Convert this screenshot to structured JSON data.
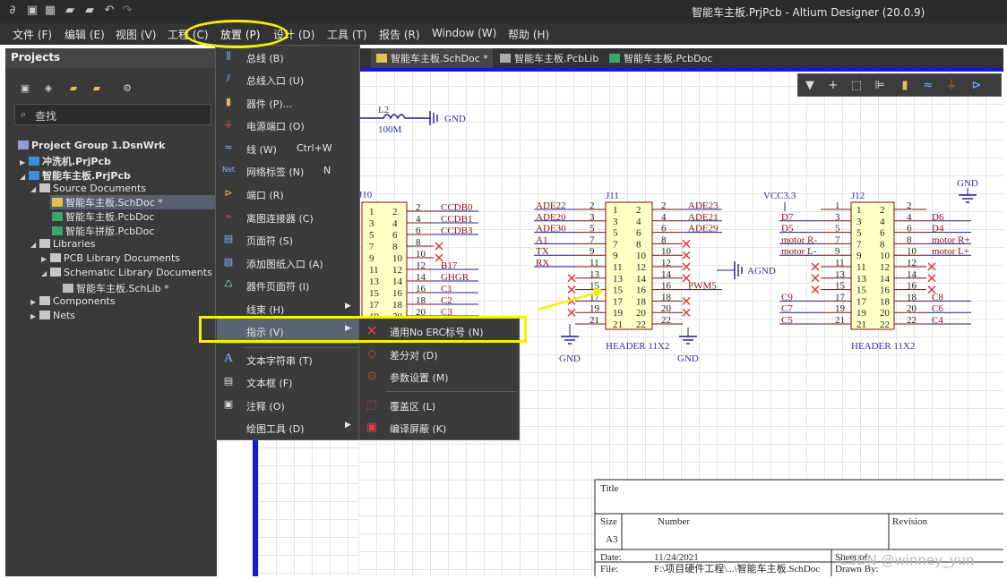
{
  "app": {
    "window_title": "智能车主板.PrjPcb - Altium Designer (20.0.9)"
  },
  "menubar": [
    {
      "label": "文件 (F)"
    },
    {
      "label": "编辑 (E)"
    },
    {
      "label": "视图 (V)"
    },
    {
      "label": "工程 (C)"
    },
    {
      "label": "放置 (P)"
    },
    {
      "label": "设计 (D)"
    },
    {
      "label": "工具 (T)"
    },
    {
      "label": "报告 (R)"
    },
    {
      "label": "Window (W)"
    },
    {
      "label": "帮助 (H)"
    }
  ],
  "projects_panel": {
    "title": "Projects",
    "search_placeholder": "查找",
    "tree": [
      {
        "label": "Project Group 1.DsnWrk"
      },
      {
        "label": "冲洗机.PrjPcb"
      },
      {
        "label": "智能车主板.PrjPcb"
      },
      {
        "label": "Source Documents"
      },
      {
        "label": "智能车主板.SchDoc *"
      },
      {
        "label": "智能车主板.PcbDoc"
      },
      {
        "label": "智能车拼版.PcbDoc"
      },
      {
        "label": "Libraries"
      },
      {
        "label": "PCB Library Documents"
      },
      {
        "label": "Schematic Library Documents"
      },
      {
        "label": "智能车主板.SchLib *"
      },
      {
        "label": "Components"
      },
      {
        "label": "Nets"
      }
    ]
  },
  "doc_tabs": [
    {
      "label": "智能车主板.SchDoc *",
      "active": true
    },
    {
      "label": "智能车主板.PcbLib"
    },
    {
      "label": "智能车主板.PcbDoc"
    }
  ],
  "place_menu": {
    "items": [
      {
        "label": "总线 (B)",
        "icon": "bus-icon"
      },
      {
        "label": "总线入口 (U)",
        "icon": "bus-entry-icon"
      },
      {
        "label": "器件 (P)...",
        "icon": "part-icon"
      },
      {
        "label": "电源端口 (O)",
        "icon": "power-port-icon"
      },
      {
        "label": "线 (W)",
        "shortcut": "Ctrl+W",
        "icon": "wire-icon"
      },
      {
        "label": "网络标签 (N)",
        "shortcut": "N",
        "icon": "net-label-icon"
      },
      {
        "label": "端口 (R)",
        "icon": "port-icon"
      },
      {
        "label": "离图连接器 (C)",
        "icon": "off-sheet-connector-icon"
      },
      {
        "label": "页面符 (S)",
        "icon": "sheet-symbol-icon"
      },
      {
        "label": "添加图纸入口 (A)",
        "icon": "sheet-entry-icon"
      },
      {
        "label": "器件页面符 (I)",
        "icon": "device-sheet-symbol-icon"
      },
      {
        "label": "线束 (H)",
        "submenu": true
      },
      {
        "label": "指示 (V)",
        "submenu": true,
        "highlighted": true
      },
      {
        "label": "文本字符串 (T)",
        "icon": "text-string-icon"
      },
      {
        "label": "文本框 (F)",
        "icon": "text-frame-icon"
      },
      {
        "label": "注释 (O)",
        "icon": "note-icon"
      },
      {
        "label": "绘图工具 (D)",
        "submenu": true
      }
    ]
  },
  "directives_submenu": {
    "items": [
      {
        "label": "通用No ERC标号 (N)",
        "icon": "no-erc-icon"
      },
      {
        "label": "差分对 (D)",
        "icon": "diff-pair-icon"
      },
      {
        "label": "参数设置 (M)",
        "icon": "parameter-set-icon"
      },
      {
        "label": "覆盖区 (L)",
        "icon": "blanket-icon"
      },
      {
        "label": "编译屏蔽 (K)",
        "icon": "compile-mask-icon"
      }
    ]
  },
  "schematic": {
    "inductor": {
      "designator": "L2",
      "value": "100M"
    },
    "gnd": "GND",
    "agnd": "AGND",
    "vcc": "VCC3.3",
    "j10": {
      "designator": "J10",
      "left_pins": [
        "1",
        "3",
        "5",
        "7",
        "9",
        "11",
        "13",
        "15",
        "17",
        "19"
      ],
      "right_pins": [
        "2",
        "4",
        "6",
        "8",
        "10",
        "12",
        "14",
        "16",
        "18",
        "20"
      ],
      "ext_pins": [
        "2",
        "4",
        "6",
        "8",
        "10",
        "12",
        "14",
        "16",
        "18",
        "20"
      ],
      "nets": [
        "CCDB0",
        "CCDB1",
        "CCDB3",
        "",
        "",
        "B17",
        "GHGR",
        "C1",
        "C2",
        "C3"
      ]
    },
    "j11": {
      "designator": "J11",
      "footprint": "HEADER 11X2",
      "left_nets": [
        "ADE22",
        "ADE20",
        "ADE30",
        "A1",
        "TX",
        "RX",
        "",
        "",
        "",
        "",
        ""
      ],
      "left_pins": [
        "1",
        "3",
        "5",
        "7",
        "9",
        "11",
        "13",
        "15",
        "17",
        "19",
        "21"
      ],
      "right_pins": [
        "2",
        "4",
        "6",
        "8",
        "10",
        "12",
        "14",
        "16",
        "18",
        "20",
        "22"
      ],
      "ext_left_pins": [
        "2",
        "3",
        "5",
        "7",
        "9",
        "11",
        "13",
        "15",
        "17",
        "19",
        "21"
      ],
      "ext_right_pins": [
        "2",
        "4",
        "6",
        "8",
        "10",
        "12",
        "14",
        "16",
        "18",
        "20",
        "22"
      ],
      "right_nets": [
        "ADE23",
        "ADE21",
        "ADE29",
        "",
        "",
        "",
        "",
        "PWM5",
        "",
        "",
        ""
      ]
    },
    "j12": {
      "designator": "J12",
      "footprint": "HEADER 11X2",
      "left_nets": [
        "",
        "D7",
        "D5",
        "motor R-",
        "motor L-",
        "",
        "",
        "",
        "C9",
        "C7",
        "C5"
      ],
      "left_pins": [
        "1",
        "3",
        "5",
        "7",
        "9",
        "11",
        "13",
        "15",
        "17",
        "19",
        "21"
      ],
      "right_pins": [
        "2",
        "4",
        "6",
        "8",
        "10",
        "12",
        "14",
        "16",
        "18",
        "20",
        "22"
      ],
      "ext_left_pins": [
        "1",
        "3",
        "5",
        "7",
        "9",
        "11",
        "13",
        "15",
        "17",
        "19",
        "21"
      ],
      "ext_right_pins": [
        "2",
        "4",
        "6",
        "8",
        "10",
        "12",
        "14",
        "16",
        "18",
        "20",
        "22"
      ],
      "right_nets": [
        "",
        "D6",
        "D4",
        "motor R+",
        "motor L+",
        "",
        "",
        "",
        "C8",
        "C6",
        "C4"
      ]
    },
    "title_block": {
      "title_label": "Title",
      "size_label": "Size",
      "size_value": "A3",
      "number_label": "Number",
      "revision_label": "Revision",
      "date_label": "Date:",
      "date_value": "11/24/2021",
      "file_label": "File:",
      "file_value": "F:\\项目硬件工程\\...\\智能车主板.SchDoc",
      "sheet_label": "Sheet of",
      "drawn_label": "Drawn By:"
    }
  },
  "watermark": "CSDN @winney_yun"
}
